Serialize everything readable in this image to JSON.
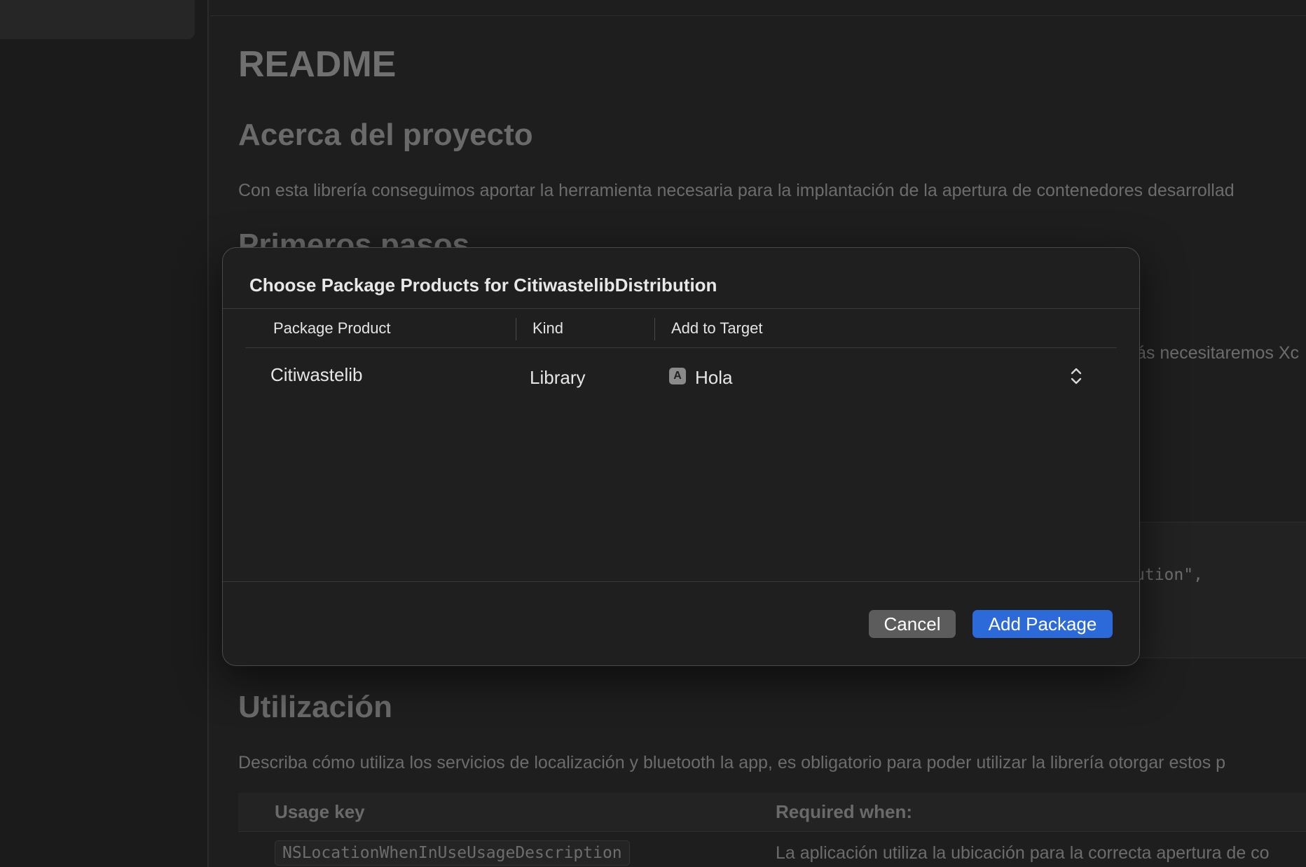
{
  "background": {
    "readme_title": "README",
    "section_about": "Acerca del proyecto",
    "about_text": "Con esta librería conseguimos aportar la herramienta necesaria para la implantación de la apertura de contenedores desarrollad",
    "section_first_steps": "Primeros pasos",
    "partial_text": "ás necesitaremos Xc",
    "code_fragment": "ution\",",
    "section_usage": "Utilización",
    "usage_text": "Describa cómo utiliza los servicios de localización y bluetooth la app, es obligatorio para poder utilizar la librería otorgar estos p",
    "table": {
      "headers": [
        "Usage key",
        "Required when:"
      ],
      "row1_key": "NSLocationWhenInUseUsageDescription",
      "row1_value": "La aplicación utiliza la ubicación para la correcta apertura de co"
    }
  },
  "dialog": {
    "title": "Choose Package Products for CitiwastelibDistribution",
    "columns": [
      "Package Product",
      "Kind",
      "Add to Target"
    ],
    "rows": [
      {
        "product": "Citiwastelib",
        "kind": "Library",
        "target": "Hola"
      }
    ],
    "cancel_label": "Cancel",
    "add_label": "Add Package"
  },
  "colors": {
    "accent": "#2d6ad9",
    "dialog_bg": "#1f1f1f",
    "cancel_bg": "#5c5c5c"
  }
}
